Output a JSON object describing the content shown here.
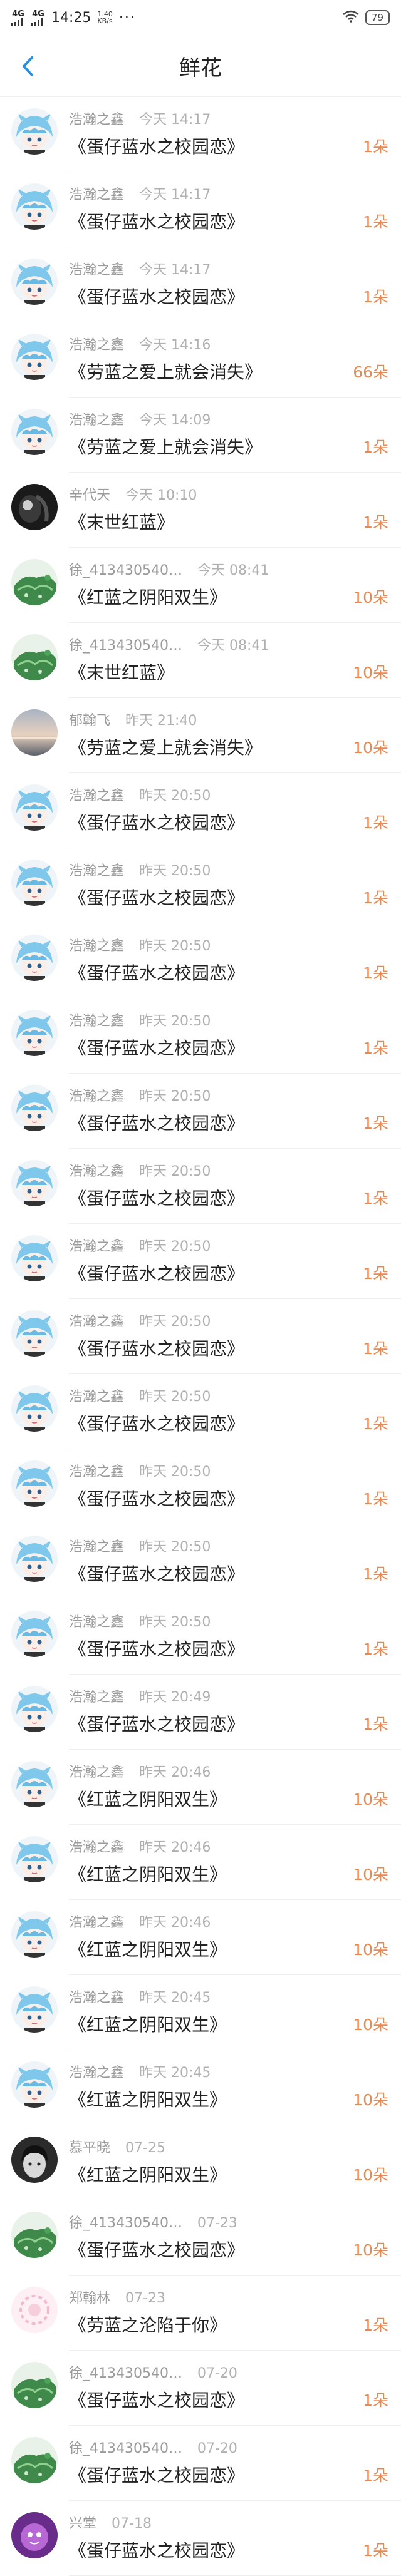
{
  "status_bar": {
    "signal1": "4G",
    "signal2": "4G",
    "time": "14:25",
    "net_speed_value": "1.40",
    "net_speed_unit": "KB/s",
    "dots": "···",
    "battery": "79"
  },
  "header": {
    "title": "鲜花"
  },
  "items": [
    {
      "user": "浩瀚之鑫",
      "time": "今天 14:17",
      "gift": "《蛋仔蓝水之校园恋》",
      "qty": "1朵",
      "avatar": "anime"
    },
    {
      "user": "浩瀚之鑫",
      "time": "今天 14:17",
      "gift": "《蛋仔蓝水之校园恋》",
      "qty": "1朵",
      "avatar": "anime"
    },
    {
      "user": "浩瀚之鑫",
      "time": "今天 14:17",
      "gift": "《蛋仔蓝水之校园恋》",
      "qty": "1朵",
      "avatar": "anime"
    },
    {
      "user": "浩瀚之鑫",
      "time": "今天 14:16",
      "gift": "《劳蓝之爱上就会消失》",
      "qty": "66朵",
      "avatar": "anime"
    },
    {
      "user": "浩瀚之鑫",
      "time": "今天 14:09",
      "gift": "《劳蓝之爱上就会消失》",
      "qty": "1朵",
      "avatar": "anime"
    },
    {
      "user": "辛代天",
      "time": "今天 10:10",
      "gift": "《末世红蓝》",
      "qty": "1朵",
      "avatar": "dark"
    },
    {
      "user": "徐_413430540…",
      "time": "今天 08:41",
      "gift": "《红蓝之阴阳双生》",
      "qty": "10朵",
      "avatar": "green"
    },
    {
      "user": "徐_413430540…",
      "time": "今天 08:41",
      "gift": "《末世红蓝》",
      "qty": "10朵",
      "avatar": "green"
    },
    {
      "user": "郁翰飞",
      "time": "昨天 21:40",
      "gift": "《劳蓝之爱上就会消失》",
      "qty": "10朵",
      "avatar": "sunset"
    },
    {
      "user": "浩瀚之鑫",
      "time": "昨天 20:50",
      "gift": "《蛋仔蓝水之校园恋》",
      "qty": "1朵",
      "avatar": "anime"
    },
    {
      "user": "浩瀚之鑫",
      "time": "昨天 20:50",
      "gift": "《蛋仔蓝水之校园恋》",
      "qty": "1朵",
      "avatar": "anime"
    },
    {
      "user": "浩瀚之鑫",
      "time": "昨天 20:50",
      "gift": "《蛋仔蓝水之校园恋》",
      "qty": "1朵",
      "avatar": "anime"
    },
    {
      "user": "浩瀚之鑫",
      "time": "昨天 20:50",
      "gift": "《蛋仔蓝水之校园恋》",
      "qty": "1朵",
      "avatar": "anime"
    },
    {
      "user": "浩瀚之鑫",
      "time": "昨天 20:50",
      "gift": "《蛋仔蓝水之校园恋》",
      "qty": "1朵",
      "avatar": "anime"
    },
    {
      "user": "浩瀚之鑫",
      "time": "昨天 20:50",
      "gift": "《蛋仔蓝水之校园恋》",
      "qty": "1朵",
      "avatar": "anime"
    },
    {
      "user": "浩瀚之鑫",
      "time": "昨天 20:50",
      "gift": "《蛋仔蓝水之校园恋》",
      "qty": "1朵",
      "avatar": "anime"
    },
    {
      "user": "浩瀚之鑫",
      "time": "昨天 20:50",
      "gift": "《蛋仔蓝水之校园恋》",
      "qty": "1朵",
      "avatar": "anime"
    },
    {
      "user": "浩瀚之鑫",
      "time": "昨天 20:50",
      "gift": "《蛋仔蓝水之校园恋》",
      "qty": "1朵",
      "avatar": "anime"
    },
    {
      "user": "浩瀚之鑫",
      "time": "昨天 20:50",
      "gift": "《蛋仔蓝水之校园恋》",
      "qty": "1朵",
      "avatar": "anime"
    },
    {
      "user": "浩瀚之鑫",
      "time": "昨天 20:50",
      "gift": "《蛋仔蓝水之校园恋》",
      "qty": "1朵",
      "avatar": "anime"
    },
    {
      "user": "浩瀚之鑫",
      "time": "昨天 20:50",
      "gift": "《蛋仔蓝水之校园恋》",
      "qty": "1朵",
      "avatar": "anime"
    },
    {
      "user": "浩瀚之鑫",
      "time": "昨天 20:49",
      "gift": "《蛋仔蓝水之校园恋》",
      "qty": "1朵",
      "avatar": "anime"
    },
    {
      "user": "浩瀚之鑫",
      "time": "昨天 20:46",
      "gift": "《红蓝之阴阳双生》",
      "qty": "10朵",
      "avatar": "anime"
    },
    {
      "user": "浩瀚之鑫",
      "time": "昨天 20:46",
      "gift": "《红蓝之阴阳双生》",
      "qty": "10朵",
      "avatar": "anime"
    },
    {
      "user": "浩瀚之鑫",
      "time": "昨天 20:46",
      "gift": "《红蓝之阴阳双生》",
      "qty": "10朵",
      "avatar": "anime"
    },
    {
      "user": "浩瀚之鑫",
      "time": "昨天 20:45",
      "gift": "《红蓝之阴阳双生》",
      "qty": "10朵",
      "avatar": "anime"
    },
    {
      "user": "浩瀚之鑫",
      "time": "昨天 20:45",
      "gift": "《红蓝之阴阳双生》",
      "qty": "10朵",
      "avatar": "anime"
    },
    {
      "user": "慕平晓",
      "time": "07-25",
      "gift": "《红蓝之阴阳双生》",
      "qty": "10朵",
      "avatar": "mono"
    },
    {
      "user": "徐_413430540…",
      "time": "07-23",
      "gift": "《蛋仔蓝水之校园恋》",
      "qty": "10朵",
      "avatar": "green"
    },
    {
      "user": "郑翰林",
      "time": "07-23",
      "gift": "《劳蓝之沦陷于你》",
      "qty": "1朵",
      "avatar": "pink"
    },
    {
      "user": "徐_413430540…",
      "time": "07-20",
      "gift": "《蛋仔蓝水之校园恋》",
      "qty": "1朵",
      "avatar": "green"
    },
    {
      "user": "徐_413430540…",
      "time": "07-20",
      "gift": "《蛋仔蓝水之校园恋》",
      "qty": "1朵",
      "avatar": "green"
    },
    {
      "user": "兴堂",
      "time": "07-18",
      "gift": "《蛋仔蓝水之校园恋》",
      "qty": "1朵",
      "avatar": "purple"
    }
  ]
}
